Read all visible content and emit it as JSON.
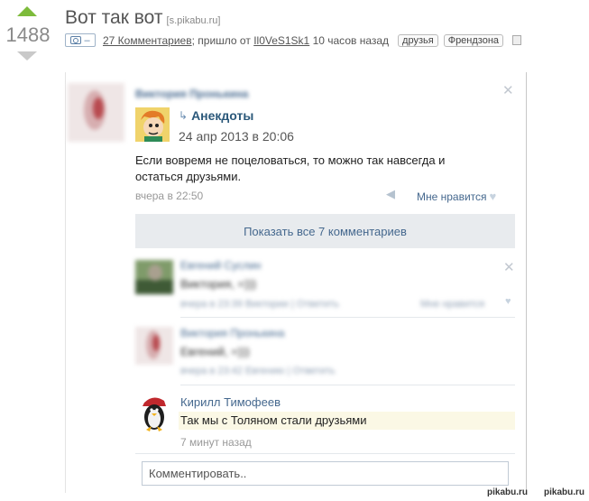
{
  "vote": {
    "score": "1488"
  },
  "post": {
    "title": "Вот так вот",
    "source": "[s.pikabu.ru]",
    "cam_suffix": "–",
    "comments_link": "27 Комментариев",
    "from_text": "; пришло от",
    "author": "Il0VeS1Sk1",
    "time_ago": "10 часов назад",
    "tags": [
      "друзья",
      "Френдзона"
    ]
  },
  "screenshot": {
    "top_user": "Виктория Пронькина",
    "group_name": "Анекдоты",
    "group_date": "24 апр 2013 в 20:06",
    "repost_text": "Если вовремя не поцеловаться, то можно так навсегда и остаться друзьями.",
    "post_time": "вчера в 22:50",
    "like_label": "Мне нравится",
    "show_all": "Показать все 7 комментариев",
    "c1": {
      "name": "Евгений Суслин",
      "text": "Виктория, =)))",
      "meta": "вчера в 23:39 Виктории | Ответить",
      "like": "Мне нравится"
    },
    "c2": {
      "name": "Виктория Пронькина",
      "text": "Евгений, =)))",
      "meta": "вчера в 23:42 Евгению | Ответить"
    },
    "c3": {
      "name": "Кирилл Тимофеев",
      "text": "Так мы с Толяном стали друзьями",
      "meta": "7 минут назад"
    },
    "comment_placeholder": "Комментировать.."
  },
  "watermarks": {
    "left": "pikabu.ru",
    "right": "pikabu.ru"
  },
  "colors": {
    "vote_up": "#7dbb3b",
    "vk_link": "#45688e",
    "show_all_bg": "#e8ebee",
    "highlight": "#fbf8e5"
  }
}
